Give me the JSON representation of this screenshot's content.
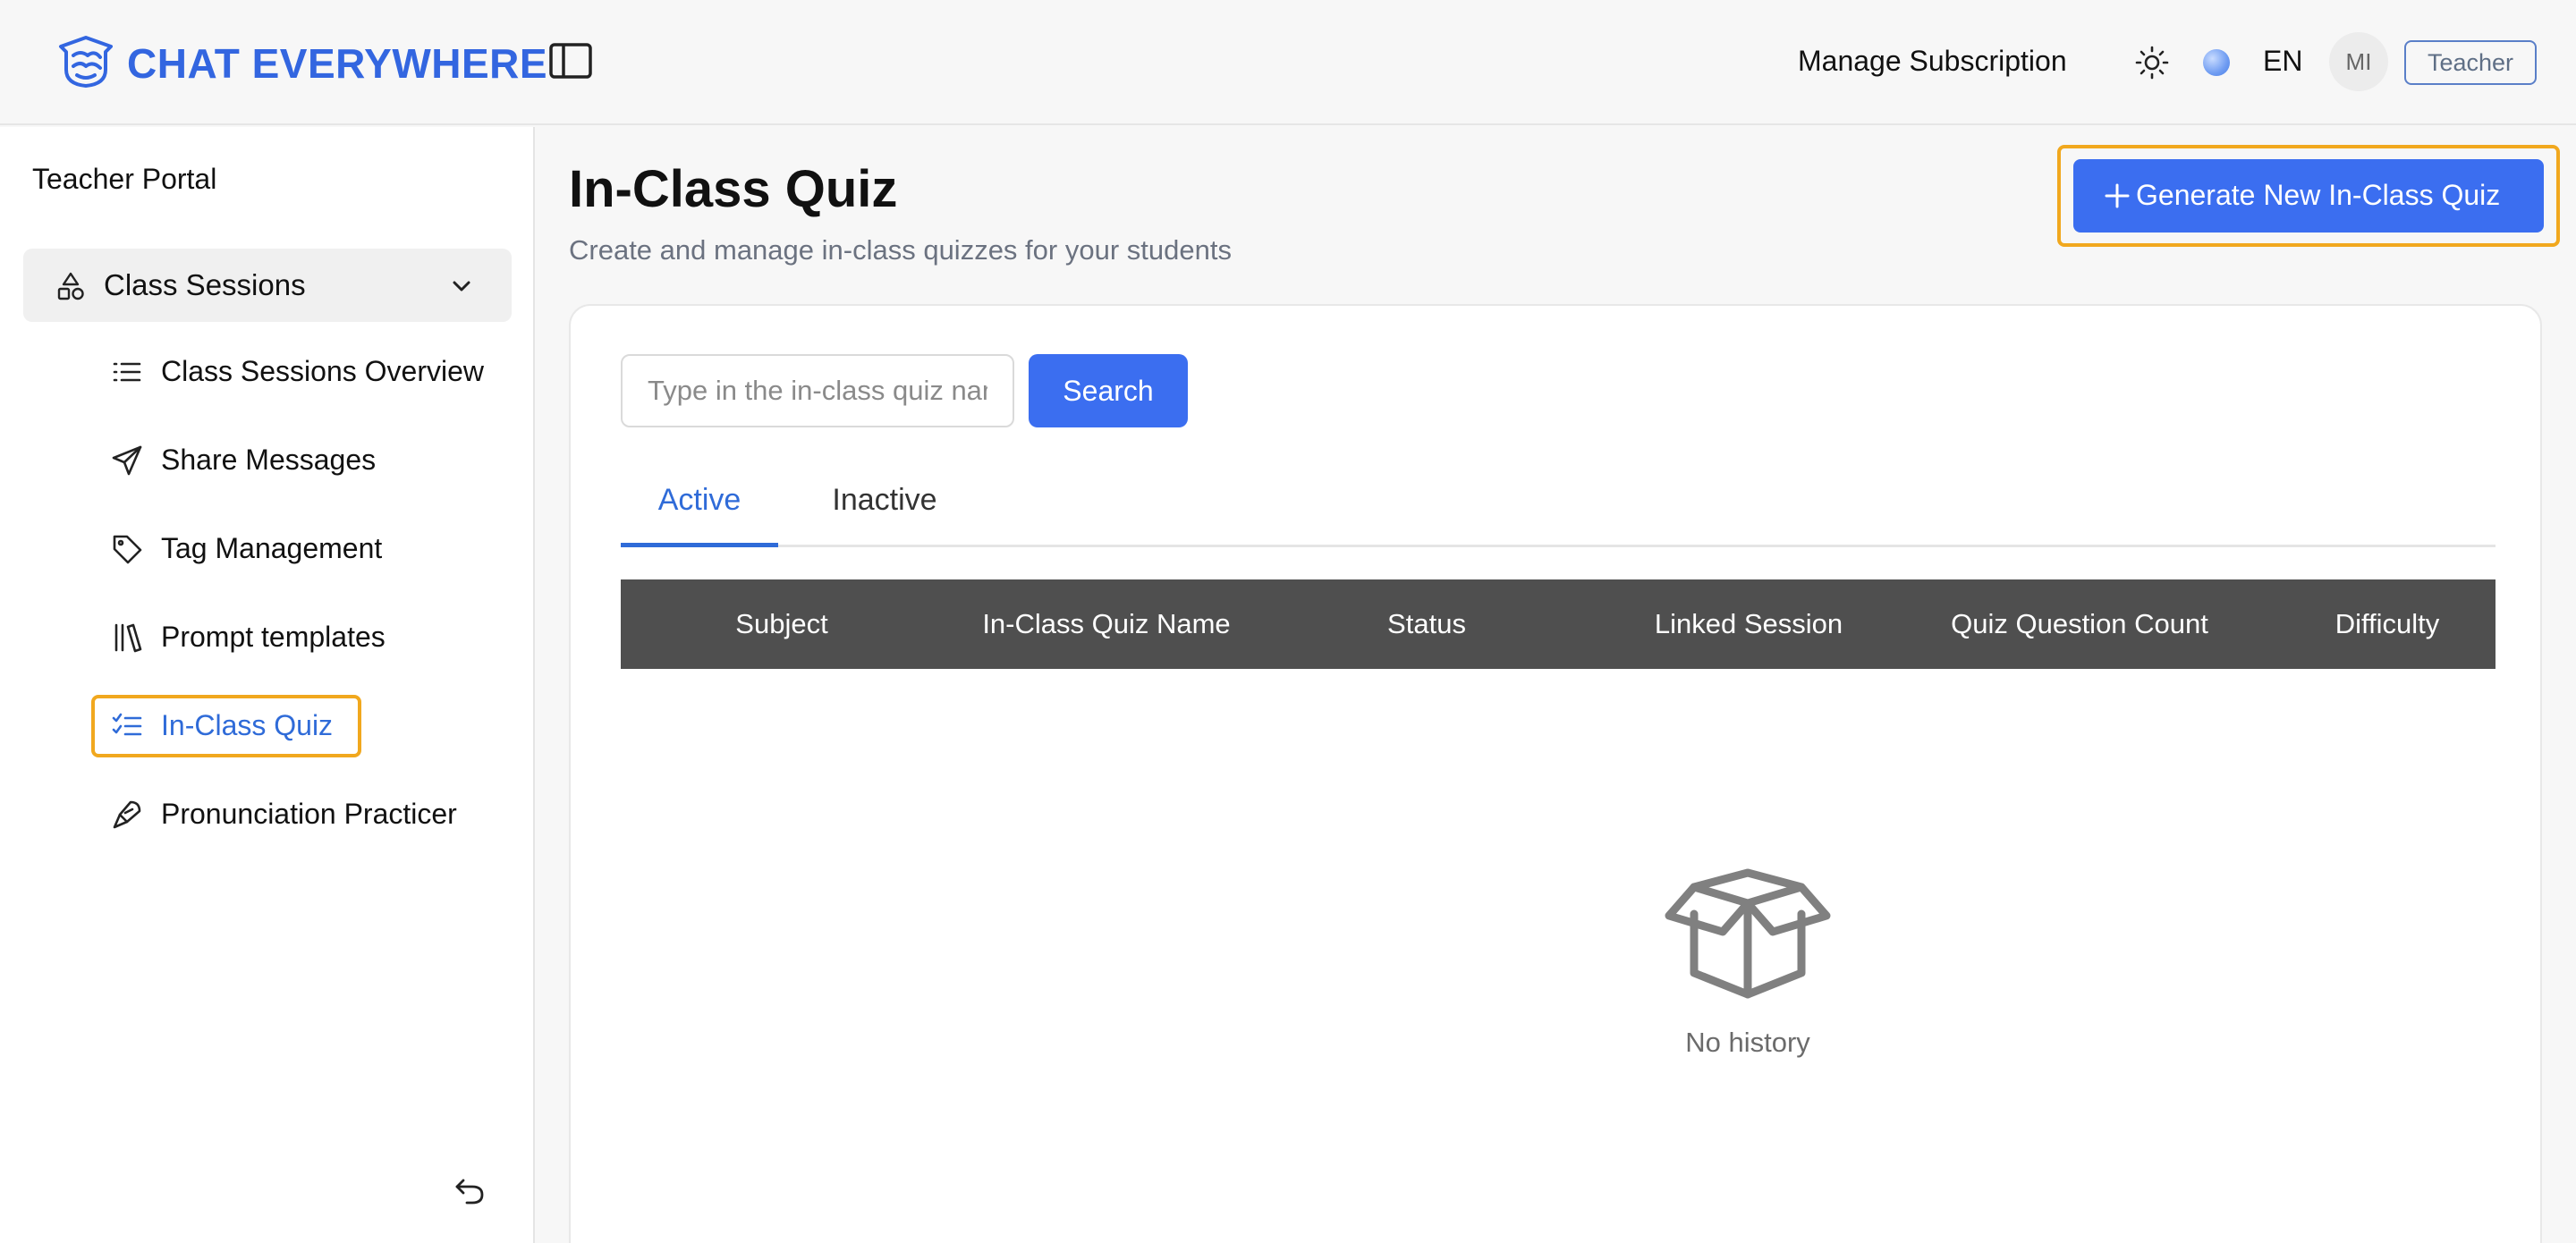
{
  "header": {
    "brand": "CHAT EVERYWHERE",
    "manage_subscription": "Manage Subscription",
    "language": "EN",
    "avatar_initials": "MI",
    "role": "Teacher",
    "icons": {
      "logo": "brain-logo-icon",
      "sidebar_toggle": "sidebar-toggle-icon",
      "theme": "sun-icon"
    }
  },
  "sidebar": {
    "title": "Teacher Portal",
    "group": {
      "label": "Class Sessions",
      "icon": "shapes-icon",
      "expanded": true
    },
    "items": [
      {
        "label": "Class Sessions Overview",
        "icon": "list-icon",
        "active": false
      },
      {
        "label": "Share Messages",
        "icon": "send-icon",
        "active": false
      },
      {
        "label": "Tag Management",
        "icon": "tag-icon",
        "active": false
      },
      {
        "label": "Prompt templates",
        "icon": "library-icon",
        "active": false
      },
      {
        "label": "In-Class Quiz",
        "icon": "checklist-icon",
        "active": true
      },
      {
        "label": "Pronunciation Practicer",
        "icon": "microphone-pen-icon",
        "active": false
      }
    ]
  },
  "main": {
    "title": "In-Class Quiz",
    "subtitle": "Create and manage in-class quizzes for your students",
    "generate_button": "Generate New In-Class Quiz",
    "search": {
      "placeholder": "Type in the in-class quiz name",
      "button": "Search"
    },
    "tabs": [
      {
        "label": "Active",
        "selected": true
      },
      {
        "label": "Inactive",
        "selected": false
      }
    ],
    "table": {
      "columns": [
        "Subject",
        "In-Class Quiz Name",
        "Status",
        "Linked Session",
        "Quiz Question Count",
        "Difficulty"
      ],
      "rows": []
    },
    "empty_state": "No history"
  },
  "colors": {
    "brand": "#3366e0",
    "primary_button": "#3b6ef0",
    "active_link": "#2f6bd8",
    "highlight_outline": "#f1a81e",
    "table_header": "#4f4f4f"
  }
}
